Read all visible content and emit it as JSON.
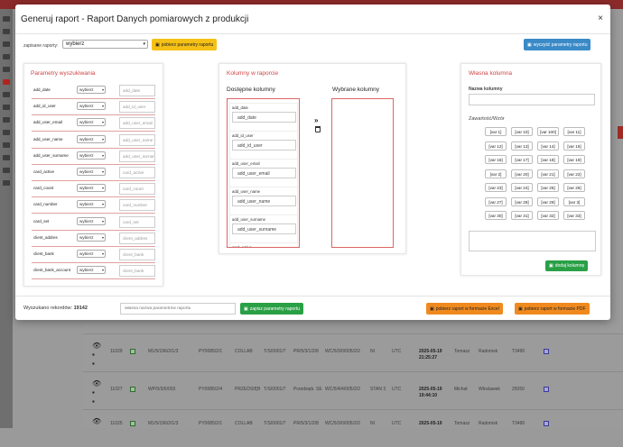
{
  "modal": {
    "title": "Generuj raport - Raport Danych pomiarowych z produkcji",
    "close": "×"
  },
  "toolbar": {
    "template_label": "zapisane raporty:",
    "template_select_value": "wybierz",
    "load_button": "pobierz parametry raportu",
    "clear_button": "wyczyść parametry raportu"
  },
  "left_panel": {
    "title": "Parametry wyszukiwania",
    "rows": [
      {
        "name": "add_date",
        "select": "wybierz",
        "input": "add_date"
      },
      {
        "name": "add_id_user",
        "select": "wybierz",
        "input": "add_id_user"
      },
      {
        "name": "add_user_email",
        "select": "wybierz",
        "input": "add_user_email"
      },
      {
        "name": "add_user_name",
        "select": "wybierz",
        "input": "add_user_name"
      },
      {
        "name": "add_user_surname",
        "select": "wybierz",
        "input": "add_user_surname"
      },
      {
        "name": "card_active",
        "select": "wybierz",
        "input": "card_active"
      },
      {
        "name": "card_count",
        "select": "wybierz",
        "input": "card_count"
      },
      {
        "name": "card_number",
        "select": "wybierz",
        "input": "card_number"
      },
      {
        "name": "card_set",
        "select": "wybierz",
        "input": "card_set"
      },
      {
        "name": "client_addres",
        "select": "wybierz",
        "input": "client_addres"
      },
      {
        "name": "client_bank",
        "select": "wybierz",
        "input": "client_bank"
      },
      {
        "name": "client_bank_account",
        "select": "wybierz",
        "input": "client_bank"
      }
    ]
  },
  "middle_panel": {
    "title": "Kolumny w raporcie",
    "available_label": "Dostępne kolumny",
    "selected_label": "Wybrane kolumny",
    "arrow": "»",
    "columns": [
      {
        "title": "add_date",
        "value": "add_date"
      },
      {
        "title": "add_id_user",
        "value": "add_id_user"
      },
      {
        "title": "add_user_email",
        "value": "add_user_email"
      },
      {
        "title": "add_user_name",
        "value": "add_user_name"
      },
      {
        "title": "add_user_surname",
        "value": "add_user_surname"
      },
      {
        "title": "card_active",
        "value": ""
      }
    ]
  },
  "right_panel": {
    "title": "Własna kolumna",
    "name_label": "Nazwa kolumny",
    "content_label": "Zawartość/Wzór",
    "vars": [
      "[var 1]",
      "[var 10]",
      "[var 100]",
      "[var 11]",
      "[var 12]",
      "[var 13]",
      "[var 14]",
      "[var 15]",
      "[var 16]",
      "[var 17]",
      "[var 18]",
      "[var 19]",
      "[var 2]",
      "[var 20]",
      "[var 21]",
      "[var 22]",
      "[var 23]",
      "[var 24]",
      "[var 25]",
      "[var 26]",
      "[var 27]",
      "[var 28]",
      "[var 29]",
      "[var 3]",
      "[var 30]",
      "[var 31]",
      "[var 32]",
      "[var 33]"
    ],
    "add_button": "dodaj kolumnę"
  },
  "footer": {
    "found_label": "Wyszukano rekordów:",
    "found_count": "19142",
    "params_placeholder": "własna nazwa parametrów raportu",
    "save_button": "zapisz parametry raportu",
    "excel_button": "pobierz raport w formacie Excel",
    "pdf_button": "pobierz raport w formacie PDF"
  },
  "background": {
    "rows": [
      {
        "c1": "11029",
        "c2": "M1/5/196/2/1/3",
        "c3": "PY0085/2/1",
        "c4": "COLLAB",
        "c5": "T/S/0001/7",
        "c6": "PR/5/3/1/2/8",
        "c7": "WC/5/3/0/005/2/2",
        "c8": "NI",
        "c9": "UTC",
        "date": "2025-05-19",
        "time": "21:25:27",
        "c10": "Tomasz",
        "c11": "Radomsk",
        "c12": "T3490"
      },
      {
        "c1": "11027",
        "c2": "WP/0/3/6/003",
        "c3": "PY0085/2/4",
        "c4": "PRZEDSIĘB",
        "c5": "T/S/0001/7",
        "c6": "Przedsięb. SE",
        "c7": "WC/5/4/4/005/2/2",
        "c8": "STAN 3",
        "c9": "UTC",
        "date": "2025-05-19",
        "time": "19:44:10",
        "c10": "Michał",
        "c11": "Włocławek",
        "c12": "25050"
      },
      {
        "c1": "11025",
        "c2": "M1/5/196/2/1/3",
        "c3": "PY0085/2/1",
        "c4": "COLLAB",
        "c5": "T/S/0001/7",
        "c6": "PR/5/3/1/2/8",
        "c7": "WC/5/3/0/005/2/2",
        "c8": "NI",
        "c9": "UTC",
        "date": "2025-05-19",
        "time": "",
        "c10": "Tomasz",
        "c11": "Radomsk",
        "c12": "T3490"
      }
    ]
  }
}
